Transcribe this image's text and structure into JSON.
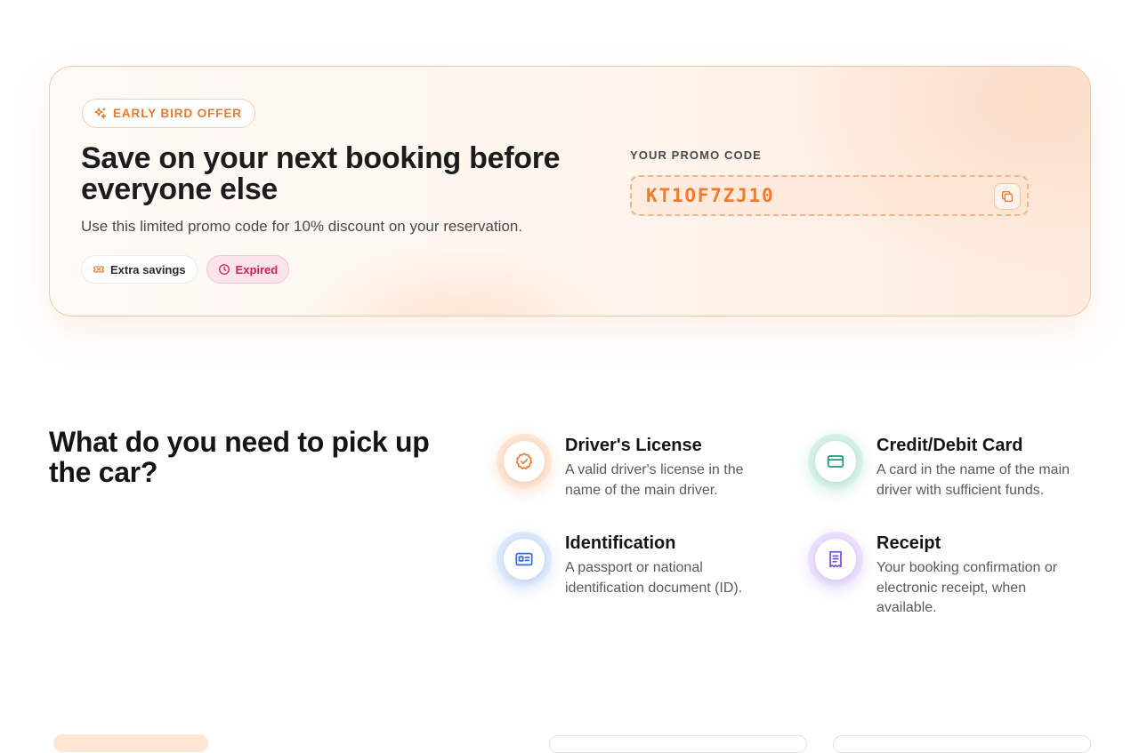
{
  "promo": {
    "badge_label": "EARLY BIRD OFFER",
    "title": "Save on your next booking before everyone else",
    "subtitle": "Use this limited promo code for 10% discount on your reservation.",
    "chips": [
      {
        "label": "Extra savings",
        "icon": "ticket-icon"
      },
      {
        "label": "Expired",
        "icon": "clock-icon",
        "status_color": "#d51f53"
      }
    ],
    "code_label": "YOUR PROMO CODE",
    "code": "KT1OF7ZJ10",
    "accent_color": "#ef7b2e"
  },
  "requirements": {
    "heading": "What do you need to pick up the car?",
    "items": [
      {
        "title": "Driver's License",
        "description": "A valid driver's license in the name of the main driver.",
        "icon": "badge-check-icon",
        "color": "#ef7b2e"
      },
      {
        "title": "Credit/Debit Card",
        "description": "A card in the name of the main driver with sufficient funds.",
        "icon": "credit-card-icon",
        "color": "#1f9a72"
      },
      {
        "title": "Identification",
        "description": "A passport or national identification document (ID).",
        "icon": "id-card-icon",
        "color": "#2f6fde"
      },
      {
        "title": "Receipt",
        "description": "Your booking confirmation or electronic receipt, when available.",
        "icon": "receipt-icon",
        "color": "#7b4fe0"
      }
    ]
  }
}
